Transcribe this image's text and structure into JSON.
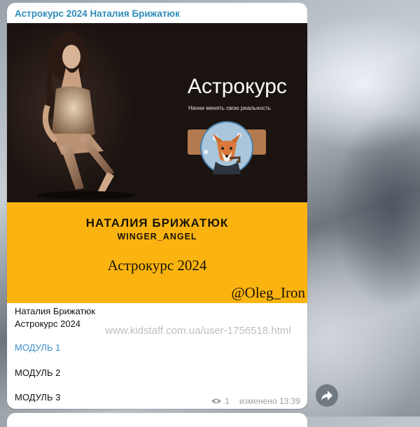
{
  "message": {
    "sender": "Астрокурс 2024 Наталия Брижатюк",
    "media": {
      "brand_title": "Астрокурс",
      "tagline": "Начни менять свою реальность",
      "author_name": "НАТАЛИЯ БРИЖАТЮК",
      "author_nick": "WINGER_ANGEL",
      "course_title": "Астрокурс 2024",
      "handle": "@Oleg_Iron"
    },
    "caption_line1": "Наталия Брижатюк",
    "caption_line2": "Астрокурс 2024",
    "watermark": "www.kidstaff.com.ua/user-1756518.html",
    "modules": [
      "МОДУЛЬ 1",
      "МОДУЛЬ 2",
      "МОДУЛЬ 3"
    ],
    "views": "1",
    "edited_label": "изменено 13:39"
  },
  "colors": {
    "sender": "#2e8bb8",
    "link": "#3a8fc8",
    "band": "#fbb40f"
  },
  "icons": {
    "views": "eye-icon",
    "share": "share-arrow-icon"
  }
}
